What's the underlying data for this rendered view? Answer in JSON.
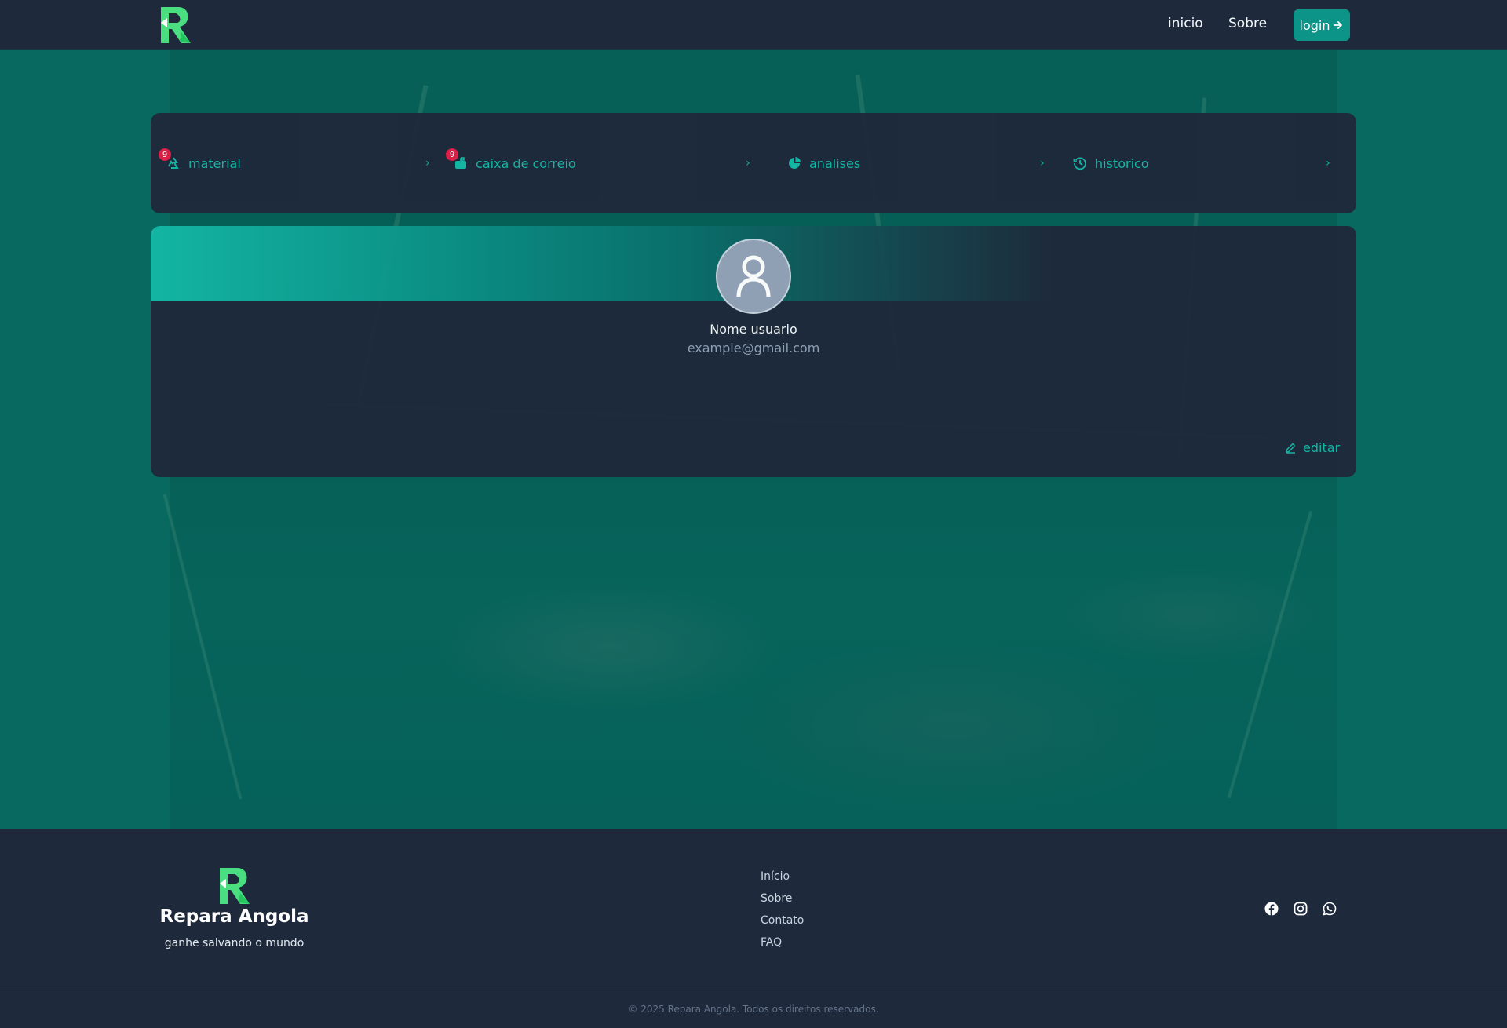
{
  "colors": {
    "accent": "#14b8a6",
    "accent_button": "#0d9488",
    "surface": "#1e293b",
    "main_bg": "#07695f",
    "badge": "#e11d48",
    "logo_green": "#4ade80"
  },
  "nav": {
    "logo_icon": "repara-logo-icon",
    "links": [
      {
        "label": "inicio"
      },
      {
        "label": "Sobre"
      }
    ],
    "login_label": "login",
    "login_icon": "arrow-right-icon"
  },
  "menu": {
    "items": [
      {
        "label": "material",
        "icon": "recycle-icon",
        "badge": "9"
      },
      {
        "label": "caixa de correio",
        "icon": "mailbox-icon",
        "badge": "9"
      },
      {
        "label": "analises",
        "icon": "pie-chart-icon",
        "badge": ""
      },
      {
        "label": "historico",
        "icon": "history-icon",
        "badge": ""
      }
    ]
  },
  "profile": {
    "name": "Nome usuario",
    "email": "example@gmail.com",
    "edit_label": "editar",
    "edit_icon": "pencil-icon",
    "avatar_icon": "user-icon"
  },
  "footer": {
    "brand_name": "Repara Angola",
    "tagline": "ganhe salvando o mundo",
    "links": [
      "Início",
      "Sobre",
      "Contato",
      "FAQ"
    ],
    "socials": [
      "facebook-icon",
      "instagram-icon",
      "whatsapp-icon"
    ],
    "copyright": "© 2025 Repara Angola. Todos os direitos reservados."
  }
}
